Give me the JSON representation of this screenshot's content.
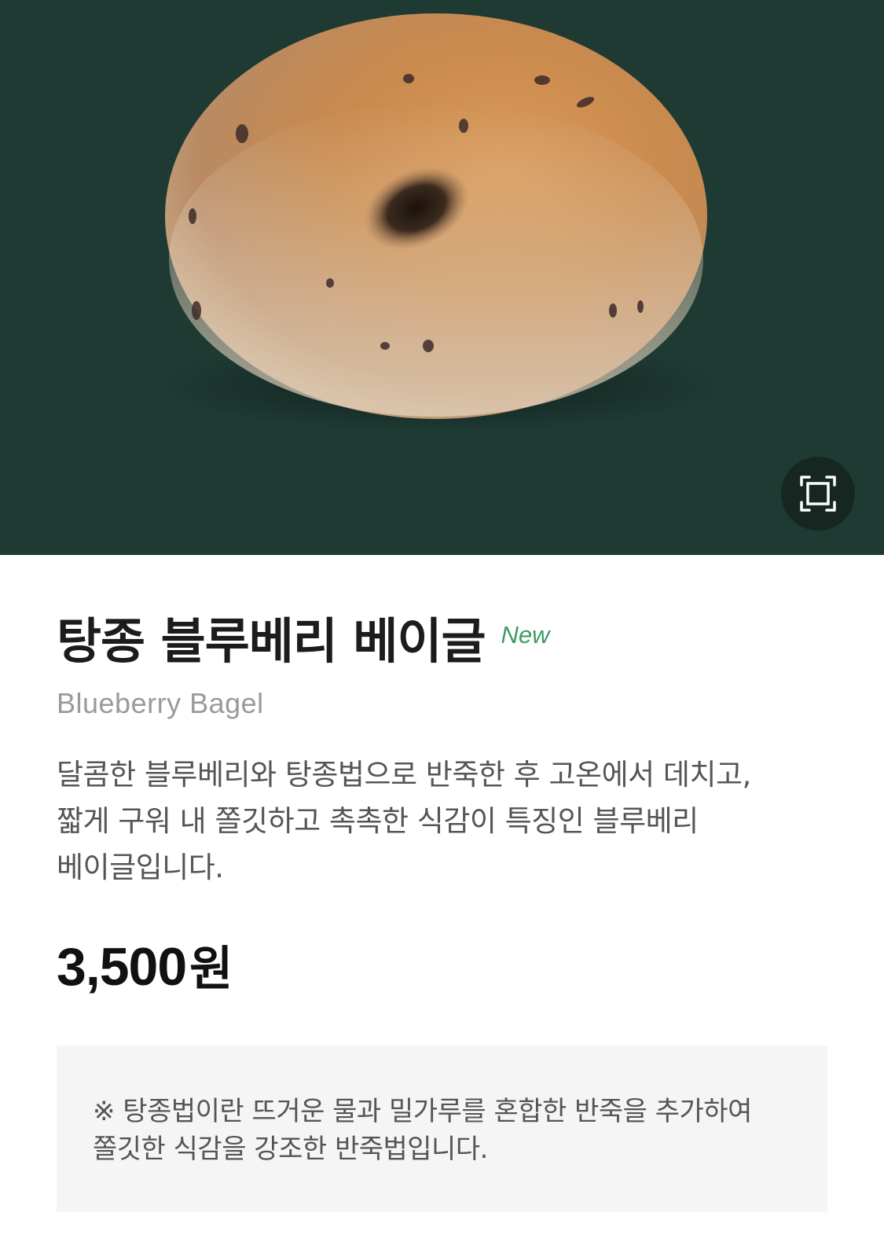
{
  "product": {
    "name_ko": "탕종 블루베리 베이글",
    "new_label": "New",
    "name_en": "Blueberry Bagel",
    "description": "달콤한 블루베리와 탕종법으로 반죽한 후 고온에서 데치고, 짧게 구워 내 쫄깃하고 촉촉한 식감이 특징인 블루베리 베이글입니다.",
    "price_value": "3,500",
    "price_unit": "원"
  },
  "note": {
    "text": "※ 탕종법이란 뜨거운 물과 밀가루를 혼합한 반죽을 추가하여 쫄깃한 식감을 강조한 반죽법입니다."
  },
  "hero": {
    "background_color": "#1e3a33",
    "image_subject": "blueberry bagel",
    "fullscreen_icon": "expand-frame-icon"
  },
  "colors": {
    "new_badge": "#3f9a63",
    "title": "#1c1c1c",
    "subtitle": "#9a9a9a",
    "note_bg": "#f5f5f5"
  }
}
